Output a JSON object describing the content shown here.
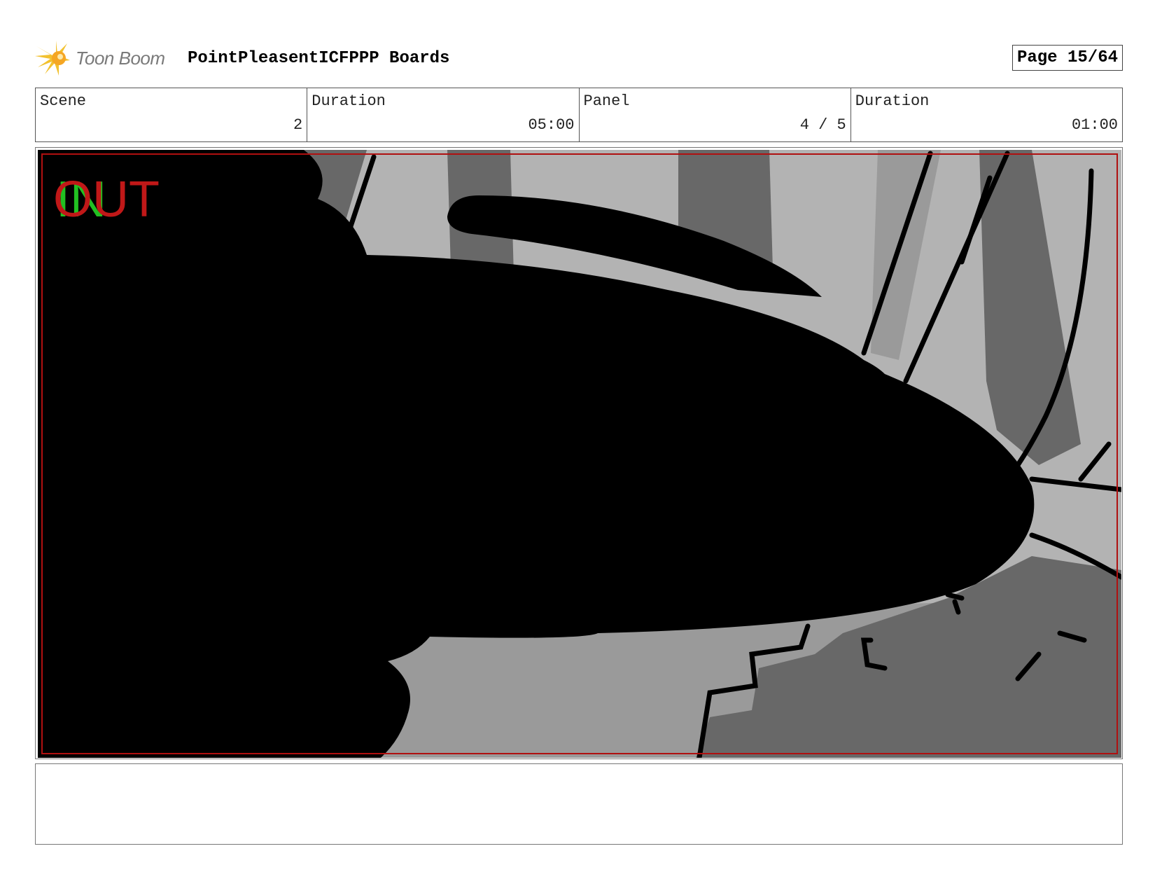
{
  "header": {
    "logo_text": "Toon Boom",
    "title": "PointPleasentICFPPP Boards",
    "page": "Page 15/64"
  },
  "info": {
    "scene_label": "Scene",
    "scene_value": "2",
    "scene_duration_label": "Duration",
    "scene_duration_value": "05:00",
    "panel_label": "Panel",
    "panel_value": "4 / 5",
    "panel_duration_label": "Duration",
    "panel_duration_value": "01:00"
  },
  "panel": {
    "in_marker": "IN",
    "out_marker": "OUT",
    "colors": {
      "light_gray": "#b3b3b3",
      "mid_gray": "#9a9a9a",
      "dark_gray": "#686868",
      "ink": "#000000",
      "frame_red": "#b01010",
      "in_green": "#22c022",
      "out_red": "#c01818"
    }
  },
  "notes": {
    "text": ""
  }
}
